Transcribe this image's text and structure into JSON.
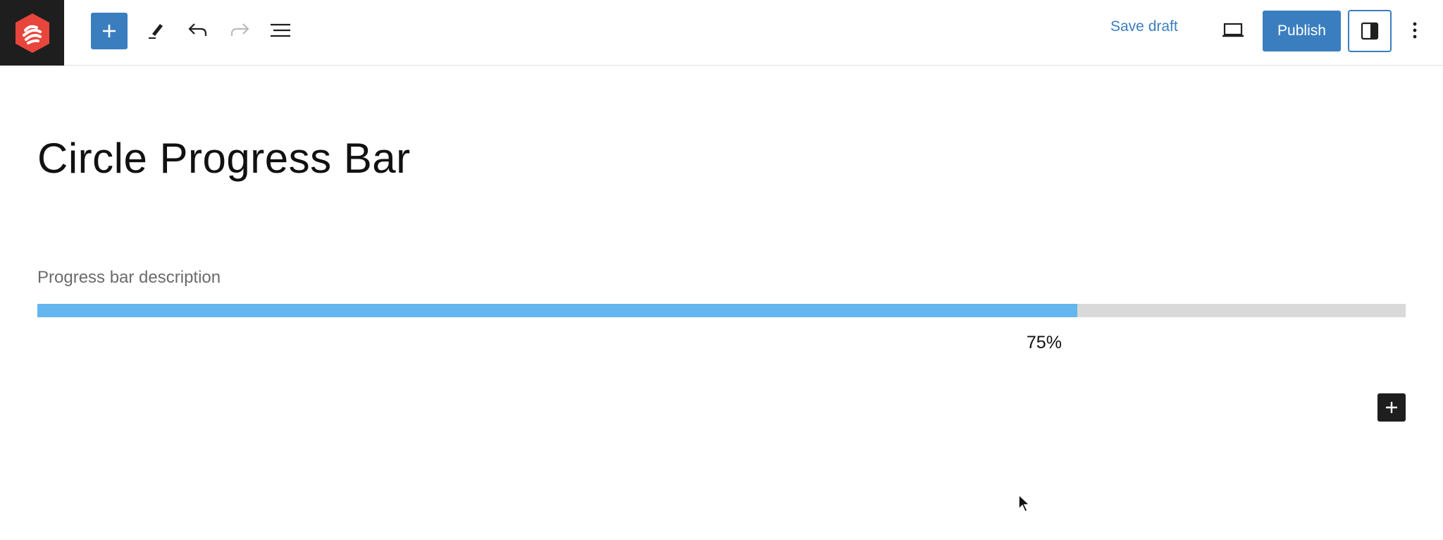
{
  "toolbar": {
    "save_draft_label": "Save draft",
    "publish_label": "Publish"
  },
  "post": {
    "title": "Circle Progress Bar"
  },
  "progress_bar": {
    "description": "Progress bar description",
    "value": 0.76,
    "value_label": "75%",
    "fill_color": "#63b6ee",
    "track_color": "#d9d9d9"
  },
  "colors": {
    "accent": "#3a7ebf",
    "logo_red": "#e8453c",
    "dark": "#1e1e1e"
  },
  "icons": [
    "logo-icon",
    "plus-icon",
    "pencil-icon",
    "undo-icon",
    "redo-icon",
    "list-view-icon",
    "laptop-icon",
    "sidebar-icon",
    "more-vertical-icon",
    "cursor-icon"
  ]
}
